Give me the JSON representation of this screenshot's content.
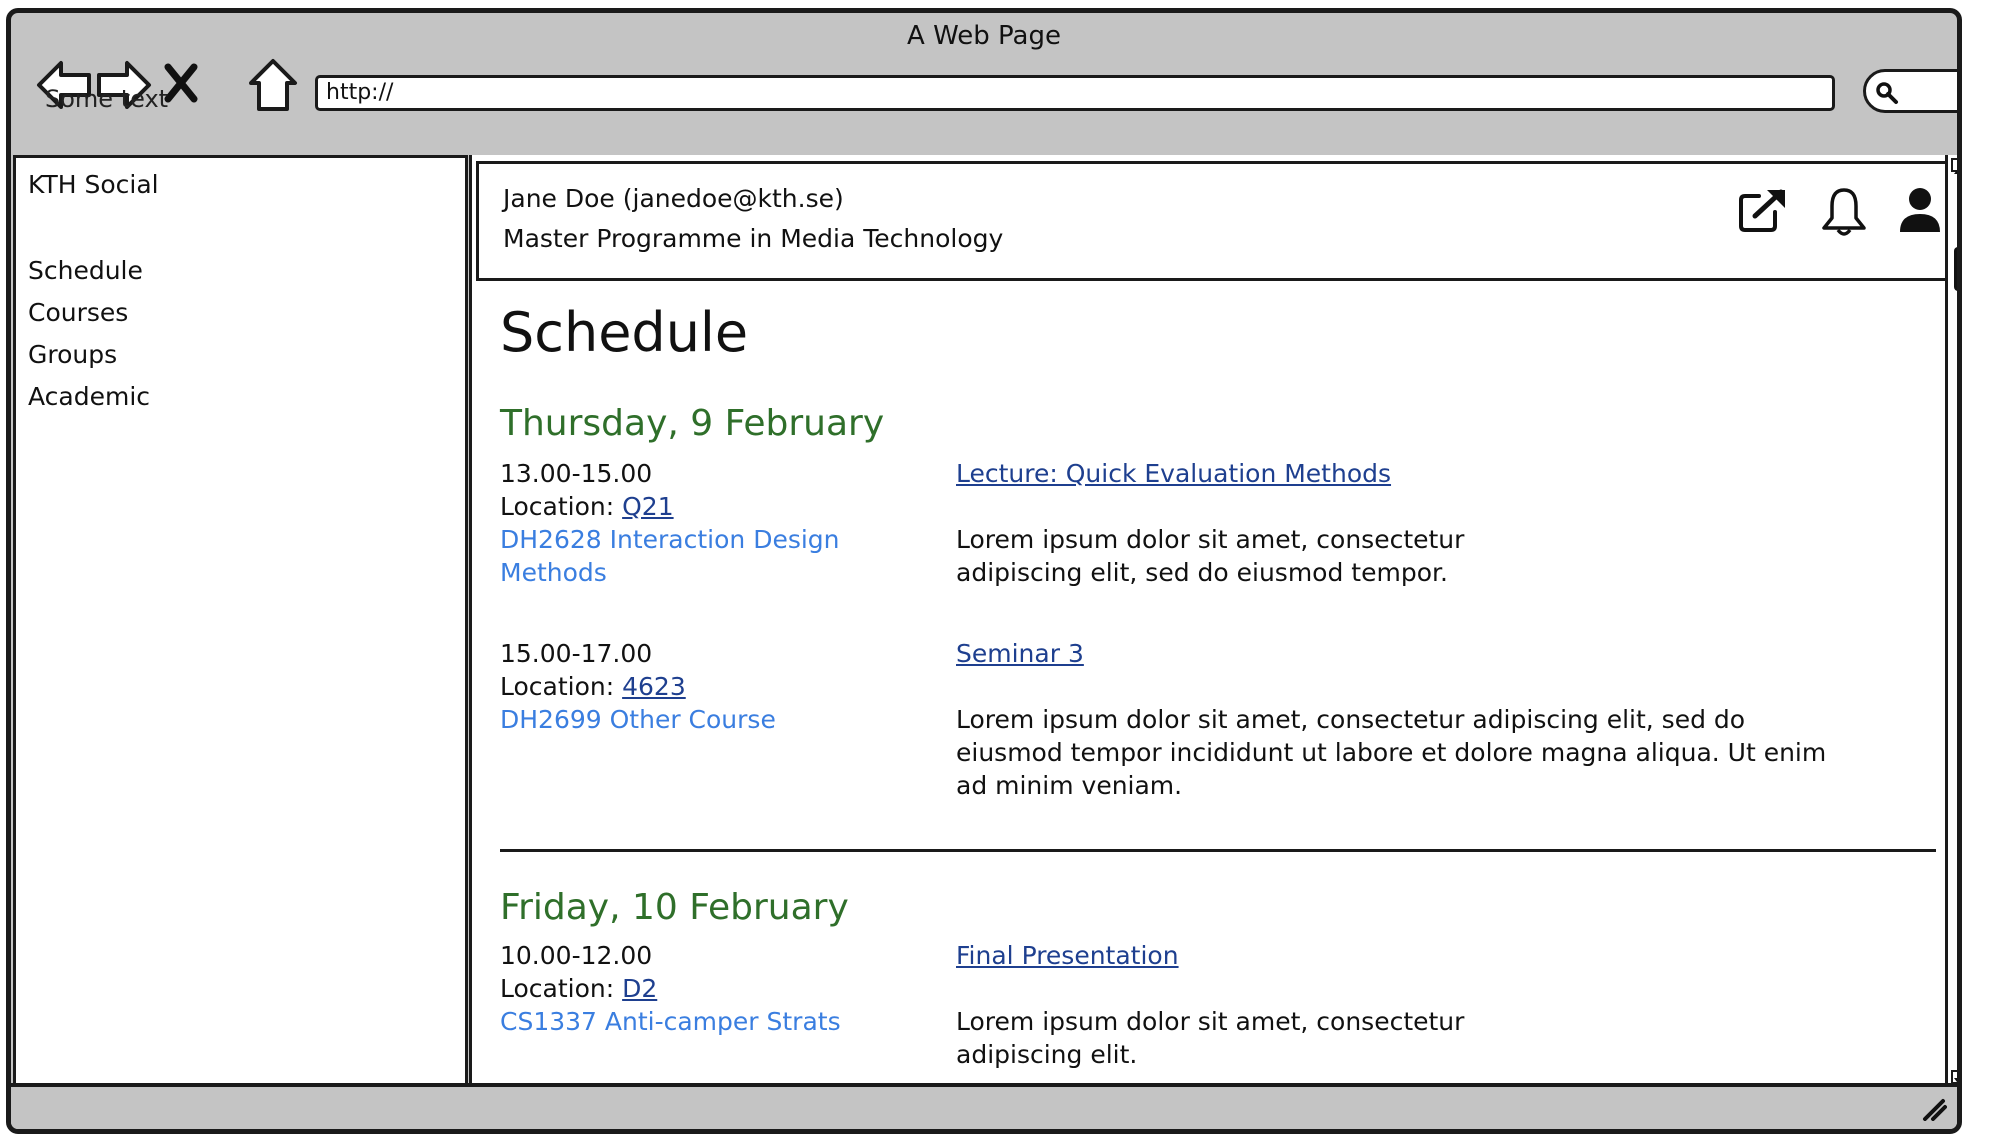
{
  "window": {
    "title": "A Web Page",
    "ghost_text": "Some text"
  },
  "address_bar": {
    "url": "http://"
  },
  "sidebar": {
    "brand": "KTH Social",
    "items": [
      {
        "label": "Schedule"
      },
      {
        "label": "Courses"
      },
      {
        "label": "Groups"
      },
      {
        "label": "Academic"
      }
    ]
  },
  "profile": {
    "name_line": "Jane Doe (janedoe@kth.se)",
    "programme": "Master Programme in Media Technology",
    "icons": [
      "external-link-icon",
      "bell-icon",
      "user-icon"
    ]
  },
  "main": {
    "title": "Schedule"
  },
  "days": [
    {
      "date": "Thursday, 9 February",
      "events": [
        {
          "time": "13.00-15.00",
          "location_label": "Location: ",
          "location": "Q21",
          "course": "DH2628 Interaction Design Methods",
          "title": "Lecture: Quick Evaluation Methods",
          "description": "Lorem ipsum dolor sit amet, consectetur adipiscing elit, sed do eiusmod tempor."
        },
        {
          "time": "15.00-17.00",
          "location_label": "Location: ",
          "location": "4623",
          "course": "DH2699 Other Course",
          "title": "Seminar 3",
          "description": "Lorem ipsum dolor sit amet, consectetur adipiscing elit, sed do eiusmod tempor incididunt ut labore et dolore magna aliqua. Ut enim ad minim veniam."
        }
      ]
    },
    {
      "date": "Friday, 10 February",
      "events": [
        {
          "time": "10.00-12.00",
          "location_label": "Location: ",
          "location": "D2",
          "course": "CS1337 Anti-camper Strats",
          "title": "Final Presentation",
          "description": "Lorem ipsum dolor sit amet, consectetur adipiscing elit."
        }
      ]
    }
  ],
  "colors": {
    "day_heading": "#2f6f2a",
    "course_link": "#3a7ee0",
    "title_link": "#1e3f8f",
    "chrome": "#c4c4c4"
  }
}
